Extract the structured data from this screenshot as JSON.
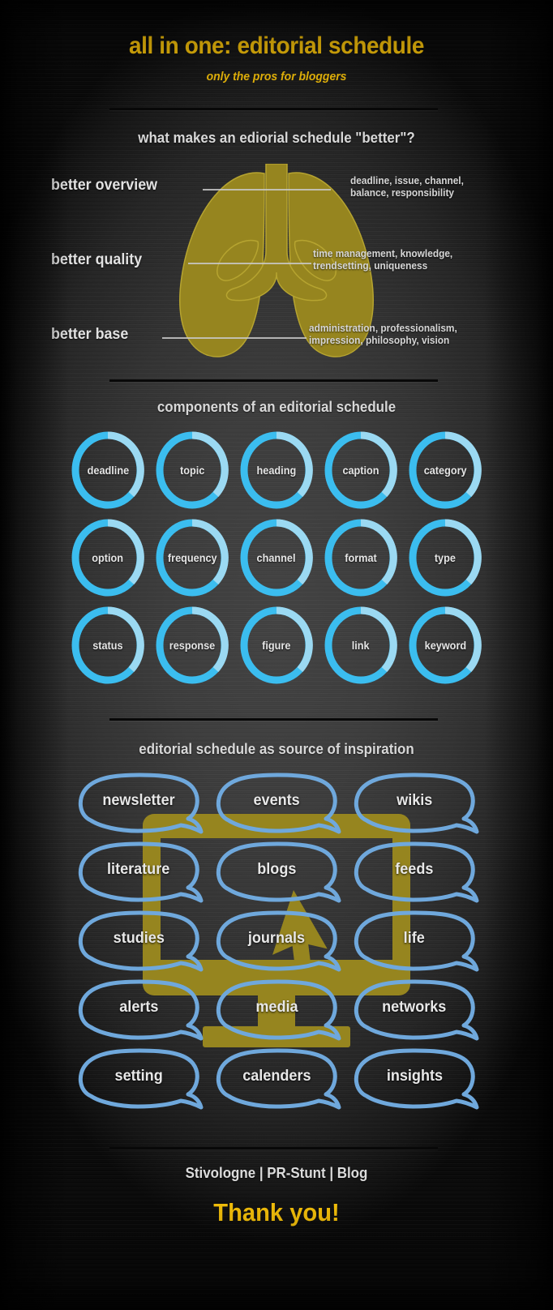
{
  "header": {
    "title": "all in one: editorial schedule",
    "subtitle": "only the pros for bloggers"
  },
  "colors": {
    "accent_yellow": "#FFC80A",
    "gold": "#96851F",
    "ring_blue": "#3BBDEF",
    "ring_blue_light": "#9BD9F2",
    "bubble_blue": "#6FA8DC",
    "text_light": "#E2E2E2",
    "background_dark": "#3A3A3A"
  },
  "section_better": {
    "heading": "what makes an ediorial schedule \"better\"?",
    "graphic": "lungs-icon",
    "rows": [
      {
        "label": "better overview",
        "detail": "deadline, issue, channel,\nbalance, responsibility"
      },
      {
        "label": "better quality",
        "detail": "time management, knowledge,\ntrendsetting, uniqueness"
      },
      {
        "label": "better base",
        "detail": "administration, professionalism,\nimpression, philosophy, vision"
      }
    ]
  },
  "section_components": {
    "heading": "components of an editorial schedule",
    "rows": [
      [
        "deadline",
        "topic",
        "heading",
        "caption",
        "category"
      ],
      [
        "option",
        "frequency",
        "channel",
        "format",
        "type"
      ],
      [
        "status",
        "response",
        "figure",
        "link",
        "keyword"
      ]
    ]
  },
  "section_inspiration": {
    "heading": "editorial schedule as source of inspiration",
    "graphic": "monitor-icon",
    "cursor": "cursor-arrow-icon",
    "rows": [
      [
        "newsletter",
        "events",
        "wikis"
      ],
      [
        "literature",
        "blogs",
        "feeds"
      ],
      [
        "studies",
        "journals",
        "life"
      ],
      [
        "alerts",
        "media",
        "networks"
      ],
      [
        "setting",
        "calenders",
        "insights"
      ]
    ]
  },
  "footer": {
    "links": "Stivologne | PR-Stunt | Blog",
    "thanks": "Thank you!"
  }
}
